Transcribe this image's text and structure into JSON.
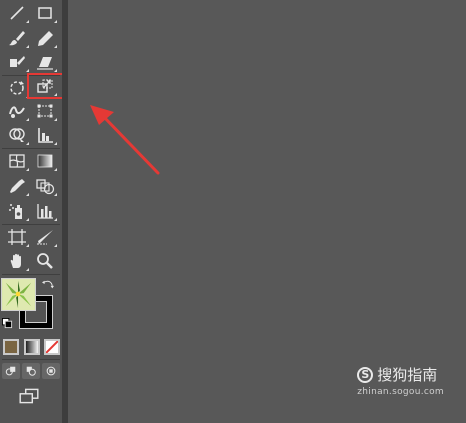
{
  "tools": {
    "items": [
      {
        "name": "line-segment-tool",
        "icon": "line-icon"
      },
      {
        "name": "rectangle-tool",
        "icon": "rectangle-icon"
      },
      {
        "name": "paintbrush-tool",
        "icon": "brush-icon"
      },
      {
        "name": "pencil-tool",
        "icon": "pencil-icon"
      },
      {
        "name": "shaper-tool",
        "icon": "shaper-icon"
      },
      {
        "name": "eraser-tool",
        "icon": "eraser-icon"
      },
      {
        "name": "rotate-tool",
        "icon": "rotate-icon"
      },
      {
        "name": "scale-tool",
        "icon": "scale-icon",
        "highlighted": true
      },
      {
        "name": "warp-tool",
        "icon": "warp-icon"
      },
      {
        "name": "free-transform-tool",
        "icon": "free-transform-icon"
      },
      {
        "name": "shape-builder-tool",
        "icon": "shape-builder-icon"
      },
      {
        "name": "perspective-grid-tool",
        "icon": "perspective-grid-icon"
      },
      {
        "name": "mesh-tool",
        "icon": "mesh-icon"
      },
      {
        "name": "gradient-tool",
        "icon": "gradient-icon"
      },
      {
        "name": "eyedropper-tool",
        "icon": "eyedropper-icon"
      },
      {
        "name": "blend-tool",
        "icon": "blend-icon"
      },
      {
        "name": "symbol-sprayer-tool",
        "icon": "symbol-sprayer-icon"
      },
      {
        "name": "column-graph-tool",
        "icon": "column-graph-icon"
      },
      {
        "name": "artboard-tool",
        "icon": "artboard-icon"
      },
      {
        "name": "slice-tool",
        "icon": "slice-icon"
      },
      {
        "name": "hand-tool",
        "icon": "hand-icon"
      },
      {
        "name": "zoom-tool",
        "icon": "zoom-icon"
      }
    ]
  },
  "colors": {
    "panel": "#535353",
    "canvas": "#585858",
    "highlight": "#e53935",
    "arrow": "#e53935",
    "fill_swatch_green": "#8bc34a",
    "stroke_swatch": "#000000"
  },
  "watermark": {
    "logo_glyph": "S",
    "title": "搜狗指南",
    "subtitle": "zhinan.sogou.com"
  }
}
